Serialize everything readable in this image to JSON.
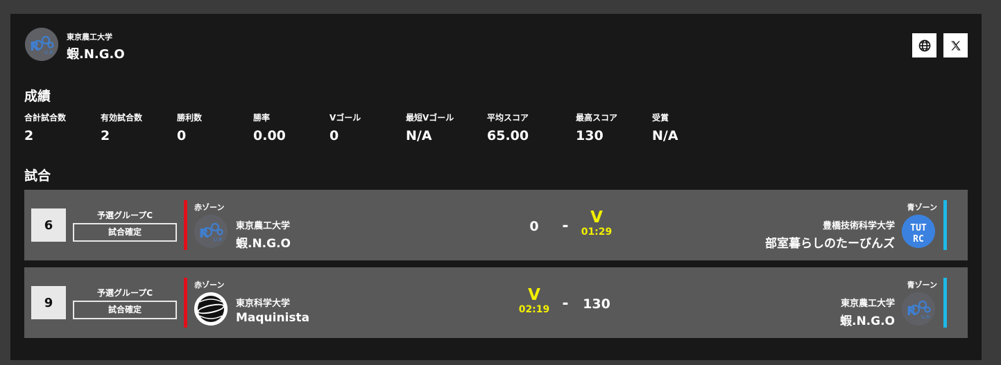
{
  "header": {
    "university": "東京農工大学",
    "team": "蝦.N.G.O",
    "website_icon": "globe-icon",
    "x_icon": "x-logo-icon"
  },
  "results": {
    "title": "成績",
    "stats": [
      {
        "label": "合計試合数",
        "value": "2"
      },
      {
        "label": "有効試合数",
        "value": "2"
      },
      {
        "label": "勝利数",
        "value": "0"
      },
      {
        "label": "勝率",
        "value": "0.00"
      },
      {
        "label": "Vゴール",
        "value": "0"
      },
      {
        "label": "最短Vゴール",
        "value": "N/A"
      },
      {
        "label": "平均スコア",
        "value": "65.00"
      },
      {
        "label": "最高スコア",
        "value": "130"
      },
      {
        "label": "受賞",
        "value": "N/A"
      }
    ]
  },
  "matches": {
    "title": "試合",
    "items": [
      {
        "number": "6",
        "group": "予選グループC",
        "status": "試合確定",
        "red": {
          "zone": "赤ゾーン",
          "university": "東京農工大学",
          "team": "蝦.N.G.O",
          "score": "0"
        },
        "separator": "-",
        "blue": {
          "zone": "青ゾーン",
          "university": "豊橋技術科学大学",
          "team": "部室暮らしのたーびんズ",
          "vgoal": "V",
          "time": "01:29"
        }
      },
      {
        "number": "9",
        "group": "予選グループC",
        "status": "試合確定",
        "red": {
          "zone": "赤ゾーン",
          "university": "東京科学大学",
          "team": "Maquinista",
          "vgoal": "V",
          "time": "02:19"
        },
        "separator": "-",
        "blue": {
          "zone": "青ゾーン",
          "university": "東京農工大学",
          "team": "蝦.N.G.O",
          "score": "130"
        }
      }
    ]
  },
  "colors": {
    "red_zone": "#e0101a",
    "blue_zone": "#1fb8e8",
    "vgoal": "#f3f000",
    "panel": "#181818",
    "row": "#595959"
  }
}
